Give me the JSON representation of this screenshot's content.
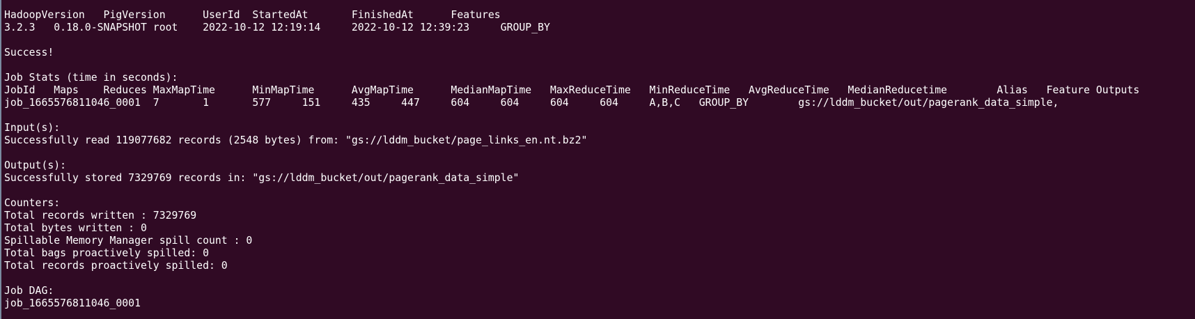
{
  "theme": {
    "background": "#300a24",
    "foreground": "#ffffff",
    "edge": "#7a8aa0"
  },
  "terminal": {
    "lines": [
      "HadoopVersion   PigVersion      UserId  StartedAt       FinishedAt      Features",
      "3.2.3   0.18.0-SNAPSHOT root    2022-10-12 12:19:14     2022-10-12 12:39:23     GROUP_BY",
      "",
      "Success!",
      "",
      "Job Stats (time in seconds):",
      "JobId   Maps    Reduces MaxMapTime      MinMapTime      AvgMapTime      MedianMapTime   MaxReduceTime   MinReduceTime   AvgReduceTime   MedianReducetime        Alias   Feature Outputs",
      "job_1665576811046_0001  7       1       577     151     435     447     604     604     604     604     A,B,C   GROUP_BY        gs://lddm_bucket/out/pagerank_data_simple,",
      "",
      "Input(s):",
      "Successfully read 119077682 records (2548 bytes) from: \"gs://lddm_bucket/page_links_en.nt.bz2\"",
      "",
      "Output(s):",
      "Successfully stored 7329769 records in: \"gs://lddm_bucket/out/pagerank_data_simple\"",
      "",
      "Counters:",
      "Total records written : 7329769",
      "Total bytes written : 0",
      "Spillable Memory Manager spill count : 0",
      "Total bags proactively spilled: 0",
      "Total records proactively spilled: 0",
      "",
      "Job DAG:",
      "job_1665576811046_0001"
    ]
  }
}
